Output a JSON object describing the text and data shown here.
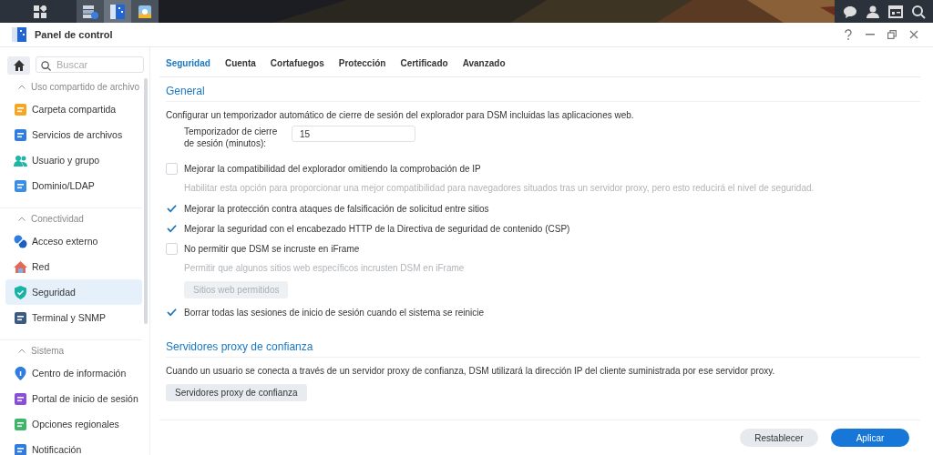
{
  "window": {
    "title": "Panel de control"
  },
  "sidebar": {
    "search": {
      "placeholder": "Buscar"
    },
    "groups": [
      {
        "label": "Uso compartido de archivo",
        "expanded": true,
        "items": [
          {
            "label": "Carpeta compartida",
            "selected": false
          },
          {
            "label": "Servicios de archivos",
            "selected": false
          },
          {
            "label": "Usuario y grupo",
            "selected": false
          },
          {
            "label": "Dominio/LDAP",
            "selected": false
          }
        ]
      },
      {
        "label": "Conectividad",
        "expanded": true,
        "items": [
          {
            "label": "Acceso externo",
            "selected": false
          },
          {
            "label": "Red",
            "selected": false
          },
          {
            "label": "Seguridad",
            "selected": true
          },
          {
            "label": "Terminal y SNMP",
            "selected": false
          }
        ]
      },
      {
        "label": "Sistema",
        "expanded": true,
        "items": [
          {
            "label": "Centro de información",
            "selected": false
          },
          {
            "label": "Portal de inicio de sesión",
            "selected": false
          },
          {
            "label": "Opciones regionales",
            "selected": false
          },
          {
            "label": "Notificación",
            "selected": false
          }
        ]
      }
    ]
  },
  "tabs": [
    {
      "label": "Seguridad",
      "selected": true
    },
    {
      "label": "Cuenta",
      "selected": false
    },
    {
      "label": "Cortafuegos",
      "selected": false
    },
    {
      "label": "Protección",
      "selected": false
    },
    {
      "label": "Certificado",
      "selected": false
    },
    {
      "label": "Avanzado",
      "selected": false
    }
  ],
  "sections": [
    {
      "title": "General",
      "rows": [
        {
          "kind": "text",
          "text": "Configurar un temporizador automático de cierre de sesión del explorador para DSM incluidas las aplicaciones web."
        },
        {
          "kind": "field",
          "label": "Temporizador de cierre de sesión (minutos):",
          "value": "15"
        },
        {
          "kind": "checkbox",
          "label": "Mejorar la compatibilidad del explorador omitiendo la comprobación de IP",
          "checked": false
        },
        {
          "kind": "hint",
          "text": "Habilitar esta opción para proporcionar una mejor compatibilidad para navegadores situados tras un servidor proxy, pero esto reducirá el nivel de seguridad."
        },
        {
          "kind": "checkbox",
          "label": "Mejorar la protección contra ataques de falsificación de solicitud entre sitios",
          "checked": true
        },
        {
          "kind": "checkbox",
          "label": "Mejorar la seguridad con el encabezado HTTP de la Directiva de seguridad de contenido (CSP)",
          "checked": true
        },
        {
          "kind": "checkbox",
          "label": "No permitir que DSM se incruste en iFrame",
          "checked": false
        },
        {
          "kind": "hint",
          "text": "Permitir que algunos sitios web específicos incrusten DSM en iFrame"
        },
        {
          "kind": "button",
          "label": "Sitios web permitidos",
          "disabled": true
        },
        {
          "kind": "checkbox",
          "label": "Borrar todas las sesiones de inicio de sesión cuando el sistema se reinicie",
          "checked": true
        }
      ]
    },
    {
      "title": "Servidores proxy de confianza",
      "rows": [
        {
          "kind": "text",
          "text": "Cuando un usuario se conecta a través de un servidor proxy de confianza, DSM utilizará la dirección IP del cliente suministrada por ese servidor proxy."
        },
        {
          "kind": "button",
          "label": "Servidores proxy de confianza",
          "disabled": false
        }
      ]
    }
  ],
  "footer": {
    "buttons": [
      {
        "label": "Restablecer",
        "primary": false
      },
      {
        "label": "Aplicar",
        "primary": true
      }
    ]
  }
}
